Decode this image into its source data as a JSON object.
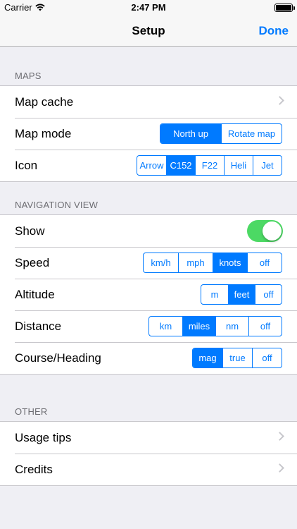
{
  "status_bar": {
    "carrier": "Carrier",
    "time": "2:47 PM"
  },
  "nav": {
    "title": "Setup",
    "done_label": "Done"
  },
  "maps": {
    "header": "MAPS",
    "map_cache_label": "Map cache",
    "map_mode_label": "Map mode",
    "map_mode_options": [
      "North up",
      "Rotate map"
    ],
    "map_mode_selected": "North up",
    "icon_label": "Icon",
    "icon_options": [
      "Arrow",
      "C152",
      "F22",
      "Heli",
      "Jet"
    ],
    "icon_selected": "C152"
  },
  "navigation_view": {
    "header": "NAVIGATION VIEW",
    "show_label": "Show",
    "show_enabled": true,
    "speed_label": "Speed",
    "speed_options": [
      "km/h",
      "mph",
      "knots",
      "off"
    ],
    "speed_selected": "knots",
    "altitude_label": "Altitude",
    "altitude_options": [
      "m",
      "feet",
      "off"
    ],
    "altitude_selected": "feet",
    "distance_label": "Distance",
    "distance_options": [
      "km",
      "miles",
      "nm",
      "off"
    ],
    "distance_selected": "miles",
    "course_label": "Course/Heading",
    "course_options": [
      "mag",
      "true",
      "off"
    ],
    "course_selected": "mag"
  },
  "other": {
    "header": "OTHER",
    "usage_tips_label": "Usage tips",
    "credits_label": "Credits"
  },
  "colors": {
    "accent": "#007aff",
    "toggle_on": "#4cd964",
    "background": "#efeff4"
  }
}
